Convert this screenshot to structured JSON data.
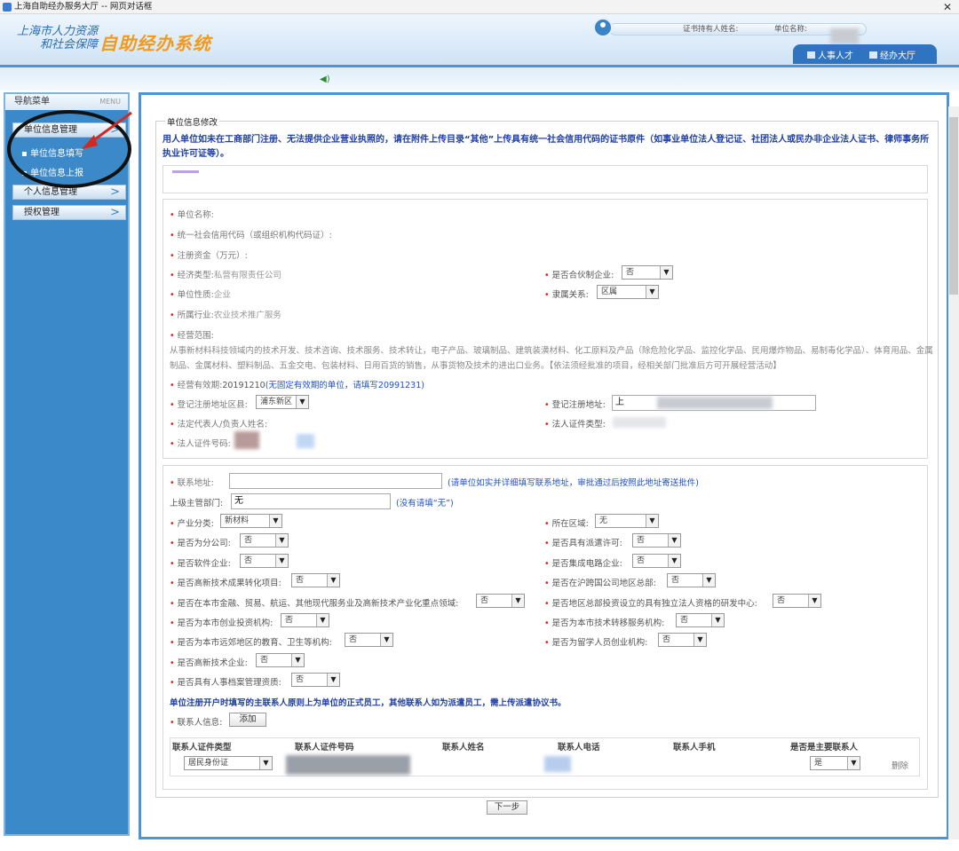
{
  "window": {
    "title": "上海自助经办服务大厅 -- 网页对话框"
  },
  "header": {
    "logo_line1": "上海市人力资源",
    "logo_line2": "和社会保障",
    "logo_main": "自助经办系统",
    "holder_label": "证书持有人姓名:",
    "unit_label": "单位名称:",
    "tabs": [
      "人事人才",
      "经办大厅"
    ]
  },
  "sidebar": {
    "title": "导航菜单",
    "menu_en": "MENU",
    "items": [
      {
        "label": "单位信息管理"
      },
      {
        "label": "个人信息管理"
      },
      {
        "label": "授权管理"
      }
    ],
    "subitems": [
      "单位信息填写",
      "单位信息上报"
    ]
  },
  "form": {
    "legend": "单位信息修改",
    "notice": "用人单位如未在工商部门注册、无法提供企业营业执照的，请在附件上传目录“其他”上传具有统一社会信用代码的证书原件（如事业单位法人登记证、社团法人或民办非企业法人证书、律师事务所执业许可证等）。",
    "unit_name_label": "单位名称:",
    "credit_code_label": "统一社会信用代码（或组织机构代码证）:",
    "capital_label": "注册资金（万元）:",
    "econ_type_label": "经济类型:",
    "econ_type_value": "私营有限责任公司",
    "partnership_label": "是否合伙制企业:",
    "partnership_value": "否",
    "unit_nature_label": "单位性质:",
    "unit_nature_value": "企业",
    "affiliation_label": "隶属关系:",
    "affiliation_value": "区属",
    "industry_label": "所属行业:",
    "industry_value": "农业技术推广服务",
    "scope_label": "经营范围:",
    "scope_value": "从事新材料科技领域内的技术开发、技术咨询、技术服务、技术转让，电子产品、玻璃制品、建筑装潢材料、化工原料及产品（除危险化学品、监控化学品、民用爆炸物品、易制毒化学品）、体育用品、金属制品、金属材料、塑料制品、五金交电、包装材料、日用百货的销售，从事货物及技术的进出口业务。【依法须经批准的项目，经相关部门批准后方可开展经营活动】",
    "valid_label": "经营有效期:",
    "valid_value": "20191210",
    "valid_hint": "(无固定有效期的单位，请填写20991231)",
    "reg_district_label": "登记注册地址区县:",
    "reg_district_value": "浦东新区",
    "reg_address_label": "登记注册地址:",
    "reg_address_value": "上",
    "legal_rep_label": "法定代表人/负责人姓名:",
    "legal_id_type_label": "法人证件类型:",
    "legal_id_no_label": "法人证件号码:",
    "contact_address_label": "联系地址:",
    "contact_address_hint": "(请单位如实并详细填写联系地址，审批通过后按照此地址寄送批件)",
    "superior_label": "上级主管部门:",
    "superior_value": "无",
    "superior_hint": "(没有请填“无”)",
    "industry_class_label": "产业分类:",
    "industry_class_value": "新材料",
    "region_label": "所在区域:",
    "region_value": "无",
    "q": [
      {
        "label": "是否为分公司:",
        "value": "否"
      },
      {
        "label": "是否具有派遣许可:",
        "value": "否"
      },
      {
        "label": "是否软件企业:",
        "value": "否"
      },
      {
        "label": "是否集成电路企业:",
        "value": "否"
      },
      {
        "label": "是否高新技术成果转化项目:",
        "value": "否"
      },
      {
        "label": "是否在沪跨国公司地区总部:",
        "value": "否"
      },
      {
        "label": "是否在本市金融、贸易、航运、其他现代服务业及高新技术产业化重点领域:",
        "value": "否"
      },
      {
        "label": "是否地区总部投资设立的具有独立法人资格的研发中心:",
        "value": "否"
      },
      {
        "label": "是否为本市创业投资机构:",
        "value": "否"
      },
      {
        "label": "是否为本市技术转移服务机构:",
        "value": "否"
      },
      {
        "label": "是否为本市远郊地区的教育、卫生等机构:",
        "value": "否"
      },
      {
        "label": "是否为留学人员创业机构:",
        "value": "否"
      },
      {
        "label": "是否高新技术企业:",
        "value": "否"
      },
      {
        "label": "是否具有人事档案管理资质:",
        "value": "否"
      }
    ],
    "contact_notice": "单位注册开户时填写的主联系人原则上为单位的正式员工，其他联系人如为派遣员工，需上传派遣协议书。",
    "contact_info_label": "联系人信息:",
    "add_button": "添加",
    "table_headers": [
      "联系人证件类型",
      "联系人证件号码",
      "联系人姓名",
      "联系人电话",
      "联系人手机",
      "是否是主要联系人"
    ],
    "row": {
      "id_type": "居民身份证",
      "is_main": "是",
      "delete": "删除"
    },
    "next_button": "下一步"
  }
}
